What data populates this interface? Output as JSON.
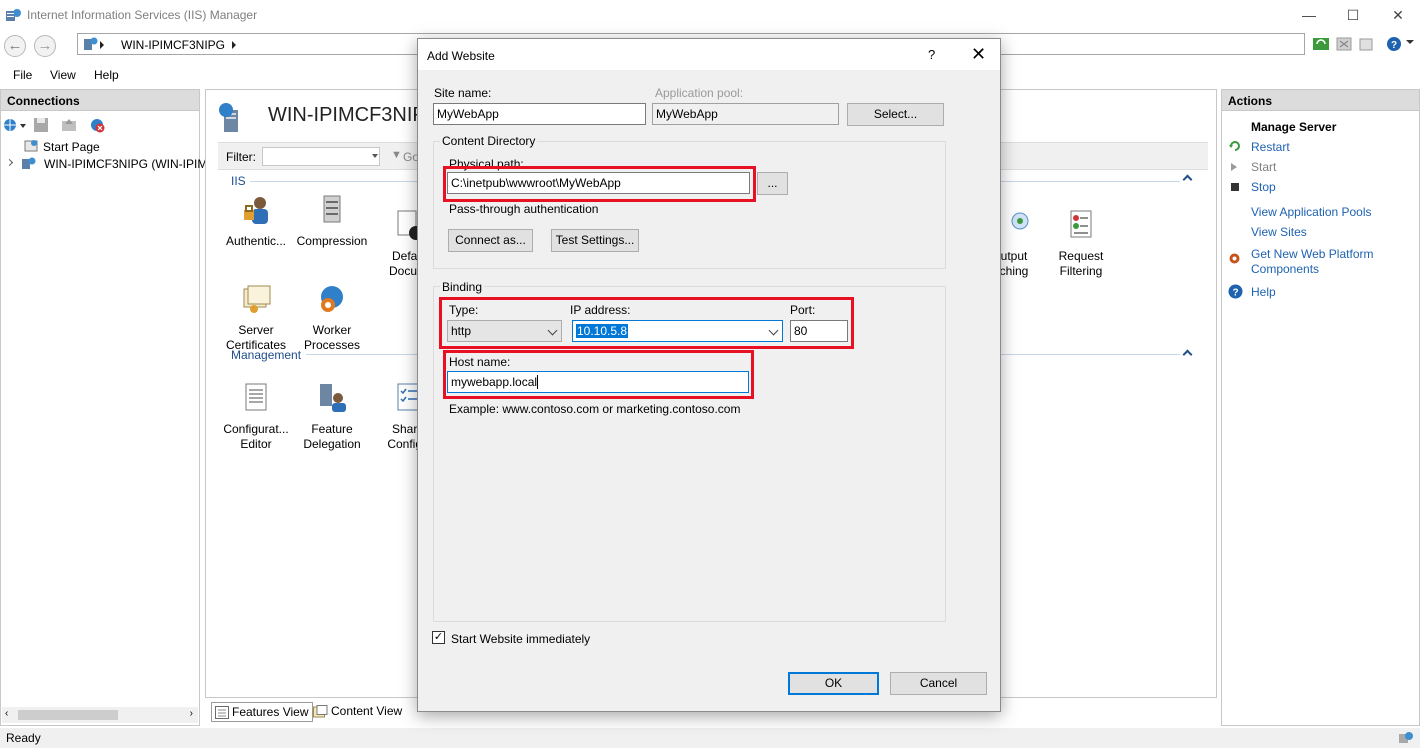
{
  "window": {
    "title": "Internet Information Services (IIS) Manager",
    "minimize": "—",
    "maximize": "☐",
    "close": "✕"
  },
  "address": {
    "crumb": "WIN-IPIMCF3NIPG"
  },
  "menu": [
    "File",
    "View",
    "Help"
  ],
  "connections": {
    "header": "Connections",
    "tree": [
      {
        "label": "Start Page"
      },
      {
        "label": "WIN-IPIMCF3NIPG (WIN-IPIM"
      }
    ]
  },
  "center": {
    "title": "WIN-IPIMCF3NIPG",
    "filter_label": "Filter:",
    "go_label": "Go",
    "groups": {
      "iis": "IIS",
      "management": "Management"
    },
    "features": [
      {
        "label": "Authentic...",
        "icon": "authentication-icon"
      },
      {
        "label": "Compression",
        "icon": "compression-icon"
      },
      {
        "label": "Defau\nDocum",
        "icon": "default-document-icon"
      },
      {
        "label": "utput\nching",
        "icon": "output-caching-icon"
      },
      {
        "label": "Request\nFiltering",
        "icon": "request-filtering-icon"
      },
      {
        "label": "Server\nCertificates",
        "icon": "server-certificates-icon"
      },
      {
        "label": "Worker\nProcesses",
        "icon": "worker-processes-icon"
      },
      {
        "label": "Configurat...\nEditor",
        "icon": "configuration-editor-icon"
      },
      {
        "label": "Feature\nDelegation",
        "icon": "feature-delegation-icon"
      },
      {
        "label": "Share\nConfigu",
        "icon": "shared-configuration-icon"
      }
    ],
    "tabs": {
      "features_view": "Features View",
      "content_view": "Content View"
    }
  },
  "actions": {
    "header": "Actions",
    "section": "Manage Server",
    "items": {
      "restart": "Restart",
      "start": "Start",
      "stop": "Stop",
      "view_pools": "View Application Pools",
      "view_sites": "View Sites",
      "web_platform": "Get New Web Platform\nComponents",
      "help": "Help"
    }
  },
  "status": {
    "text": "Ready"
  },
  "dialog": {
    "title": "Add Website",
    "help": "?",
    "close": "✕",
    "site_name_label": "Site name:",
    "site_name_value": "MyWebApp",
    "app_pool_label": "Application pool:",
    "app_pool_value": "MyWebApp",
    "select_button": "Select...",
    "content_dir_title": "Content Directory",
    "physical_path_label": "Physical path:",
    "physical_path_value": "C:\\inetpub\\wwwroot\\MyWebApp",
    "browse_button": "...",
    "pass_through_label": "Pass-through authentication",
    "connect_as_button": "Connect as...",
    "test_settings_button": "Test Settings...",
    "binding_title": "Binding",
    "type_label": "Type:",
    "type_value": "http",
    "ip_label": "IP address:",
    "ip_value": "10.10.5.8",
    "port_label": "Port:",
    "port_value": "80",
    "host_label": "Host name:",
    "host_value": "mywebapp.local",
    "example_text": "Example: www.contoso.com or marketing.contoso.com",
    "start_immediately_label": "Start Website immediately",
    "start_immediately_checked": "✓",
    "ok_button": "OK",
    "cancel_button": "Cancel"
  },
  "colors": {
    "highlight_red": "#e81123",
    "link_blue": "#1e62b0",
    "selection_blue": "#0078d7"
  }
}
